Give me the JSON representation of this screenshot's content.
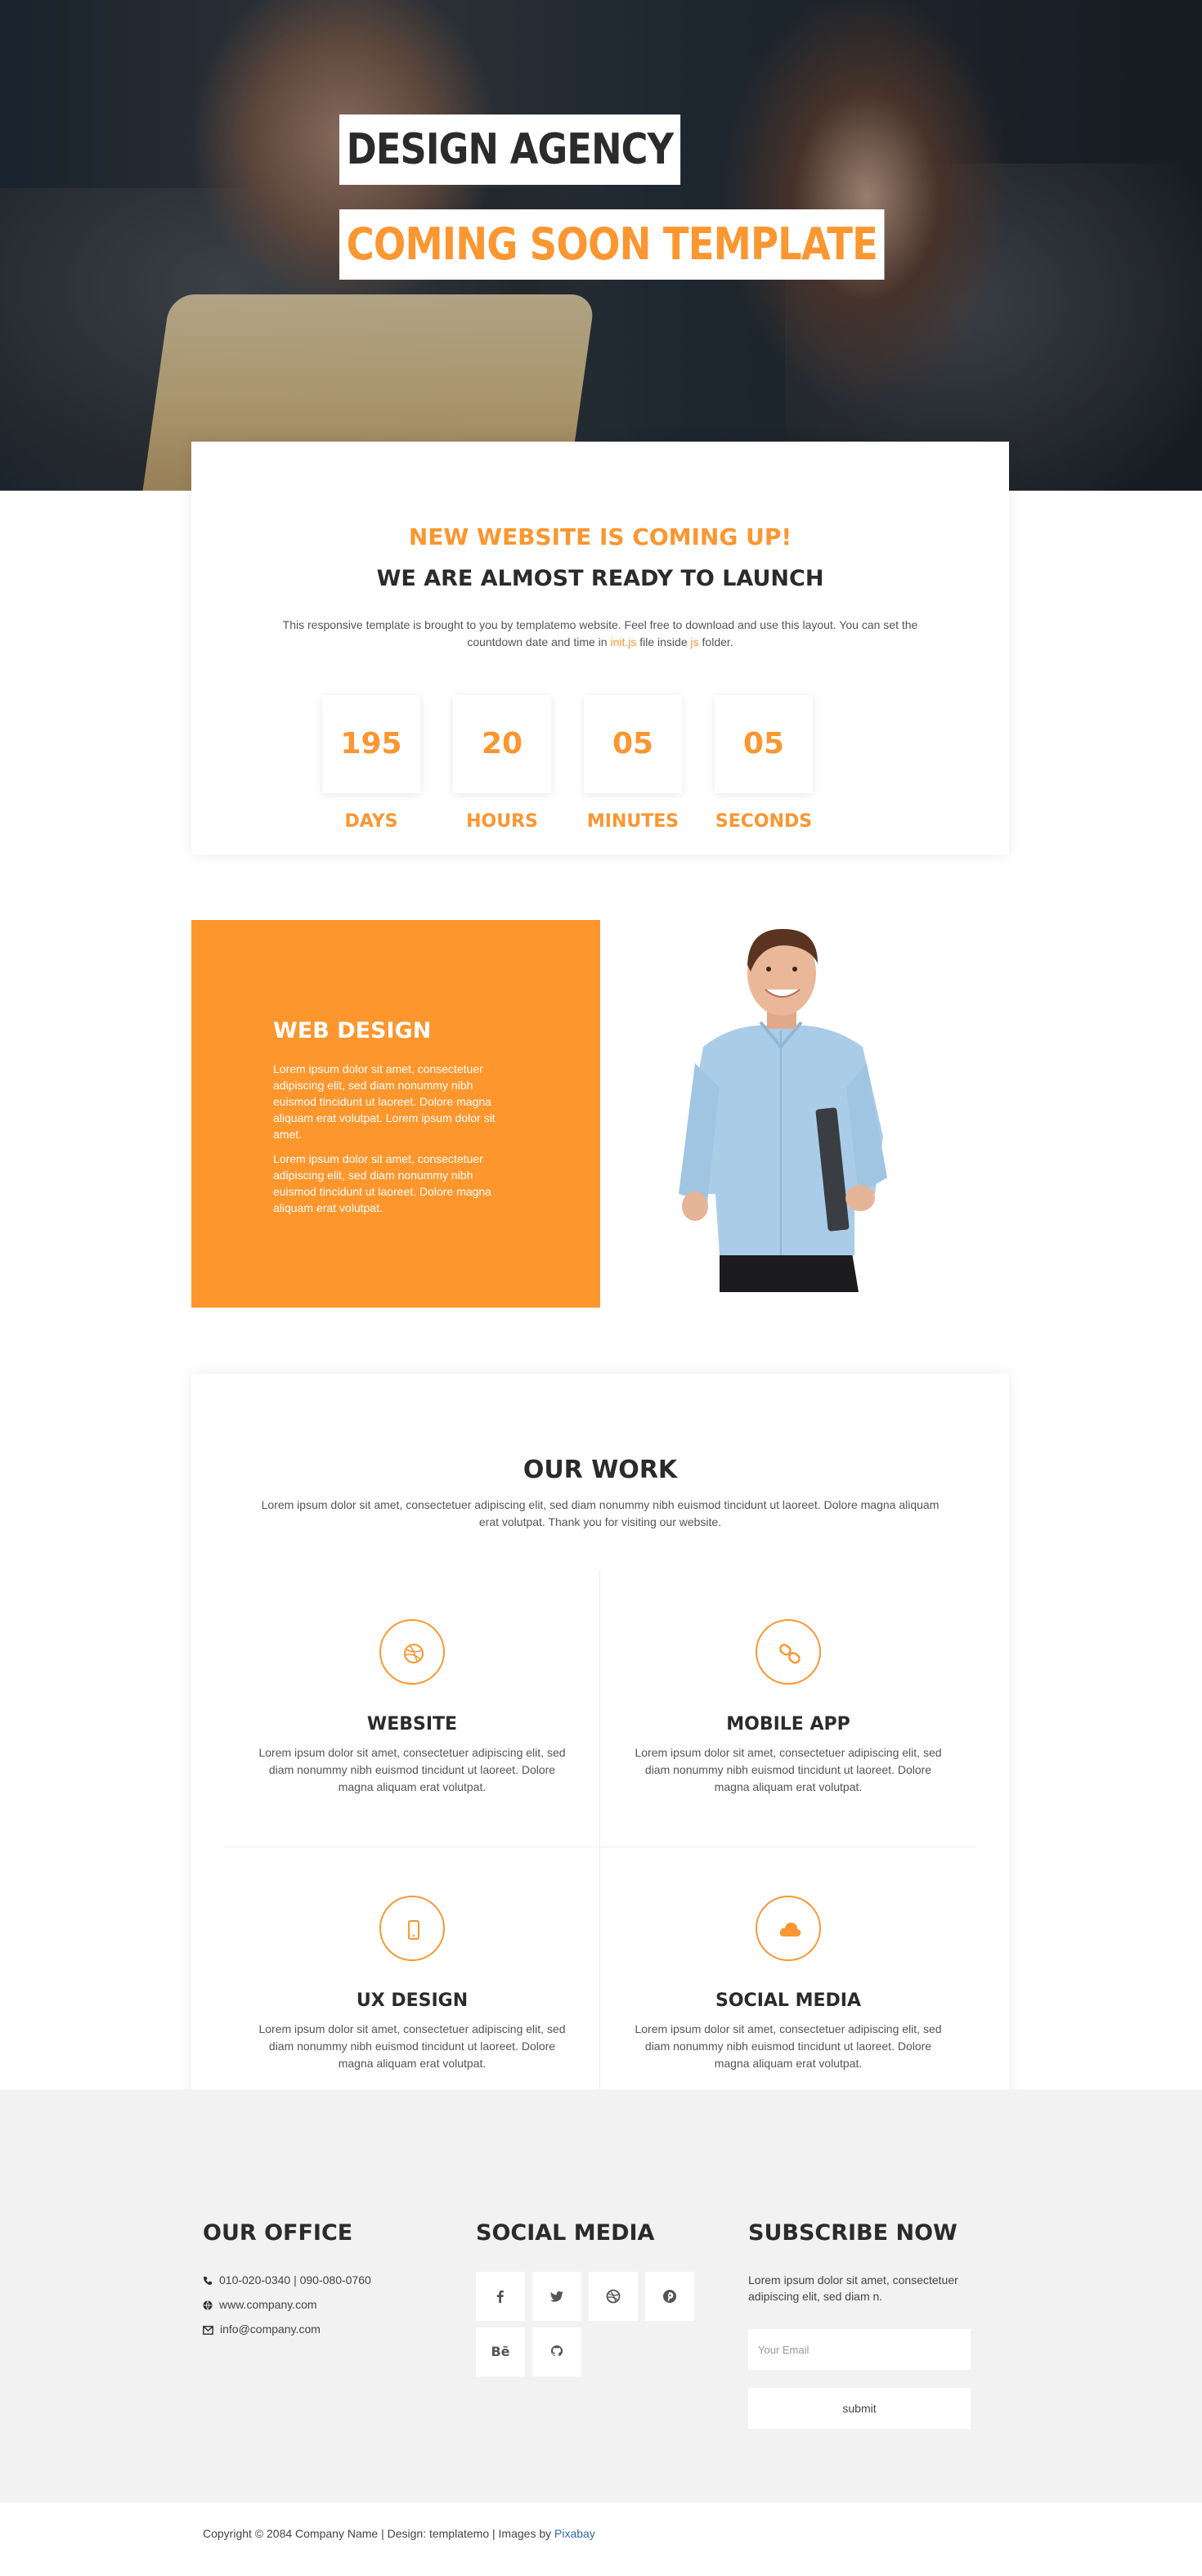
{
  "hero": {
    "title_line1": "DESIGN AGENCY",
    "title_line2": "COMING SOON TEMPLATE"
  },
  "countdown": {
    "subtitle": "NEW WEBSITE IS COMING UP!",
    "title": "WE ARE ALMOST READY TO LAUNCH",
    "desc_part1": "This responsive template is brought to you by templatemo website. Feel free to download and use this layout. You can set the countdown date and time in ",
    "desc_link1": "init.js",
    "desc_part2": " file inside ",
    "desc_link2": "js",
    "desc_part3": " folder.",
    "items": [
      {
        "value": "195",
        "label": "DAYS"
      },
      {
        "value": "20",
        "label": "HOURS"
      },
      {
        "value": "05",
        "label": "MINUTES"
      },
      {
        "value": "05",
        "label": "SECONDS"
      }
    ]
  },
  "web_design": {
    "title": "WEB DESIGN",
    "paragraph1": "Lorem ipsum dolor sit amet, consectetuer adipiscing elit, sed diam nonummy nibh euismod tincidunt ut laoreet. Dolore magna aliquam erat volutpat. Lorem ipsum dolor sit amet.",
    "paragraph2": "Lorem ipsum dolor sit amet, consectetuer adipiscing elit, sed diam nonummy nibh euismod tincidunt ut laoreet. Dolore magna aliquam erat volutpat."
  },
  "work": {
    "title": "OUR WORK",
    "desc": "Lorem ipsum dolor sit amet, consectetuer adipiscing elit, sed diam nonummy nibh euismod tincidunt ut laoreet. Dolore magna aliquam erat volutpat. Thank you for visiting our website.",
    "services": [
      {
        "title": "WEBSITE",
        "icon": "dribbble-icon",
        "text": "Lorem ipsum dolor sit amet, consectetuer adipiscing elit, sed diam nonummy nibh euismod tincidunt ut laoreet. Dolore magna aliquam erat volutpat."
      },
      {
        "title": "MOBILE APP",
        "icon": "link-icon",
        "text": "Lorem ipsum dolor sit amet, consectetuer adipiscing elit, sed diam nonummy nibh euismod tincidunt ut laoreet. Dolore magna aliquam erat volutpat."
      },
      {
        "title": "UX DESIGN",
        "icon": "mobile-icon",
        "text": "Lorem ipsum dolor sit amet, consectetuer adipiscing elit, sed diam nonummy nibh euismod tincidunt ut laoreet. Dolore magna aliquam erat volutpat."
      },
      {
        "title": "SOCIAL MEDIA",
        "icon": "cloud-icon",
        "text": "Lorem ipsum dolor sit amet, consectetuer adipiscing elit, sed diam nonummy nibh euismod tincidunt ut laoreet. Dolore magna aliquam erat volutpat."
      }
    ]
  },
  "footer": {
    "office": {
      "title": "OUR OFFICE",
      "phone": "010-020-0340 | 090-080-0760",
      "website": "www.company.com",
      "email": "info@company.com"
    },
    "social": {
      "title": "SOCIAL MEDIA",
      "icons": [
        "facebook-icon",
        "twitter-icon",
        "dribbble-icon",
        "pinterest-icon",
        "behance-icon",
        "github-icon"
      ],
      "behance_text": "Bē"
    },
    "subscribe": {
      "title": "SUBSCRIBE NOW",
      "desc": "Lorem ipsum dolor sit amet, consectetuer adipiscing elit, sed diam n.",
      "placeholder": "Your Email",
      "button": "submit"
    },
    "copyright_text": "Copyright © 2084 Company Name | Design: templatemo | Images by ",
    "copyright_link": "Pixabay"
  },
  "colors": {
    "accent": "#fb9630",
    "dark": "#2b2b2b",
    "footer_bg": "#f2f2f2"
  }
}
